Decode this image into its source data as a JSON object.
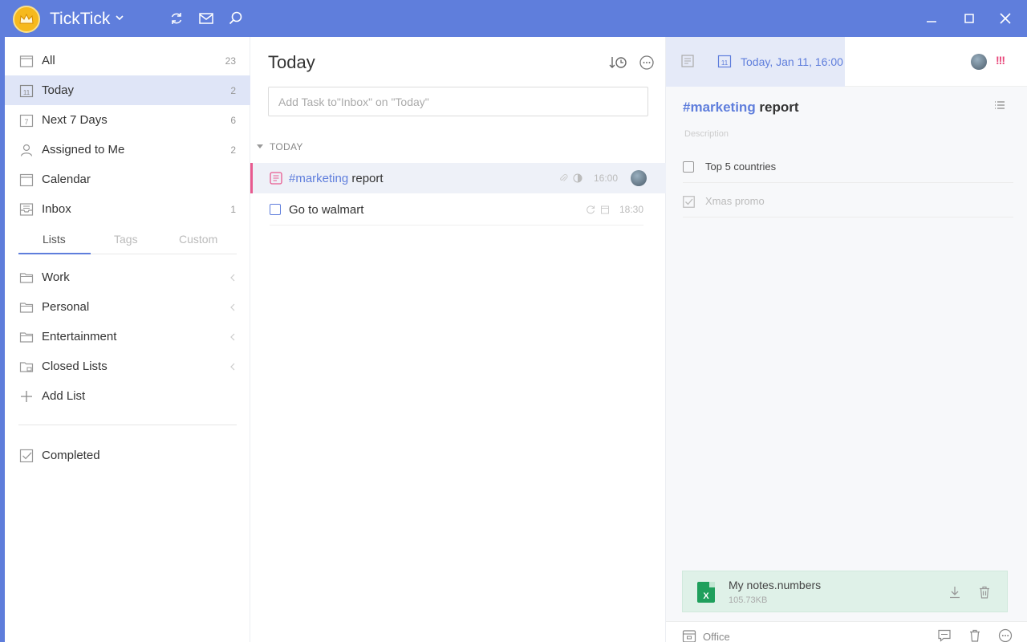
{
  "app": {
    "title": "TickTick"
  },
  "sidebar": {
    "items": [
      {
        "label": "All",
        "count": "23"
      },
      {
        "label": "Today",
        "count": "2"
      },
      {
        "label": "Next 7 Days",
        "count": "6"
      },
      {
        "label": "Assigned to Me",
        "count": "2"
      },
      {
        "label": "Calendar",
        "count": ""
      },
      {
        "label": "Inbox",
        "count": "1"
      }
    ],
    "tabs": [
      "Lists",
      "Tags",
      "Custom"
    ],
    "lists": [
      "Work",
      "Personal",
      "Entertainment",
      "Closed Lists"
    ],
    "add_list": "Add List",
    "completed": "Completed"
  },
  "main": {
    "title": "Today",
    "add_placeholder": "Add Task to\"Inbox\" on \"Today\"",
    "section": "TODAY",
    "tasks": [
      {
        "tag": "#marketing",
        "text": " report",
        "time": "16:00"
      },
      {
        "text": "Go to walmart",
        "time": "18:30"
      }
    ]
  },
  "detail": {
    "date": "Today, Jan 11, 16:00",
    "priority": "!!!",
    "title_tag": "#marketing",
    "title_rest": " report",
    "description_placeholder": "Description",
    "subtasks": [
      {
        "text": "Top 5 countries",
        "done": false
      },
      {
        "text": "Xmas promo",
        "done": true
      }
    ],
    "attachment": {
      "name": "My notes.numbers",
      "size": "105.73KB",
      "type_letter": "X"
    },
    "footer_list": "Office"
  },
  "colors": {
    "accent": "#5f7edc",
    "priority": "#e8477a",
    "selected_bar": "#e85a8f",
    "attachment_bg": "#dff1e8"
  }
}
